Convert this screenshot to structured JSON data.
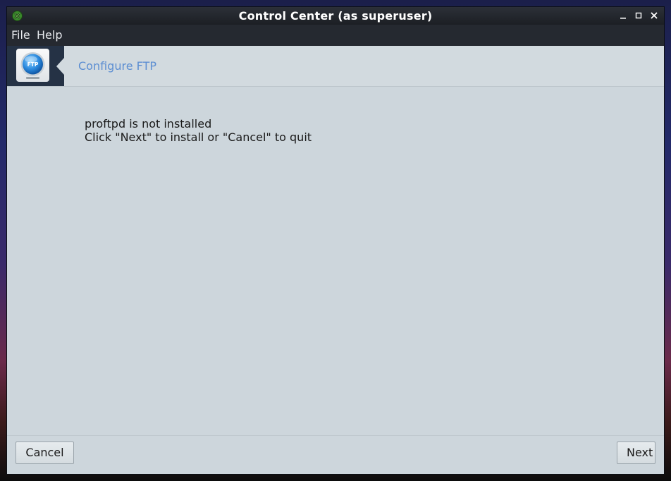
{
  "window": {
    "title": "Control Center (as superuser)",
    "controls": {
      "minimize_icon": "minimize-icon",
      "maximize_icon": "maximize-icon",
      "close_icon": "close-icon"
    }
  },
  "menubar": {
    "items": [
      {
        "label": "File"
      },
      {
        "label": "Help"
      }
    ]
  },
  "header": {
    "icon_name": "ftp-icon",
    "icon_text": "FTP",
    "title": "Configure FTP"
  },
  "message": {
    "line1": "proftpd is not installed",
    "line2": "Click \"Next\" to install or \"Cancel\" to quit"
  },
  "buttons": {
    "cancel": "Cancel",
    "next": "Next"
  },
  "colors": {
    "accent": "#5c8ed2",
    "window_background": "#cdd6dc",
    "icon_block": "#253245"
  }
}
